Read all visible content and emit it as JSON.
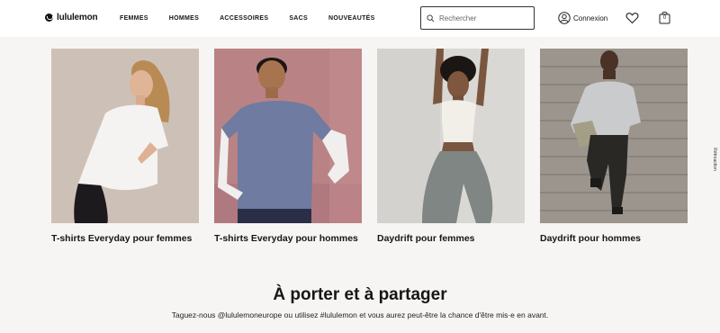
{
  "brand": {
    "name": "lululemon"
  },
  "nav": {
    "items": [
      "FEMMES",
      "HOMMES",
      "ACCESSOIRES",
      "SACS",
      "NOUVEAUTÉS"
    ]
  },
  "search": {
    "placeholder": "Rechercher",
    "value": ""
  },
  "account": {
    "label": "Connexion"
  },
  "bag": {
    "count": "0"
  },
  "icons": {
    "logo": "lululemon-logo",
    "search": "search-icon",
    "account": "user-circle-icon",
    "wishlist": "heart-icon",
    "bag": "shopping-bag-icon"
  },
  "cards": [
    {
      "title": "T-shirts Everyday pour femmes"
    },
    {
      "title": "T-shirts Everyday pour hommes"
    },
    {
      "title": "Daydrift pour femmes"
    },
    {
      "title": "Daydrift pour hommes"
    }
  ],
  "feedback": {
    "label": "Rétroaction"
  },
  "section": {
    "title": "À porter et à partager",
    "subtitle": "Taguez-nous @lululemoneurope ou utilisez #lululemon et vous aurez peut-être la chance d'être mis·e en avant."
  }
}
